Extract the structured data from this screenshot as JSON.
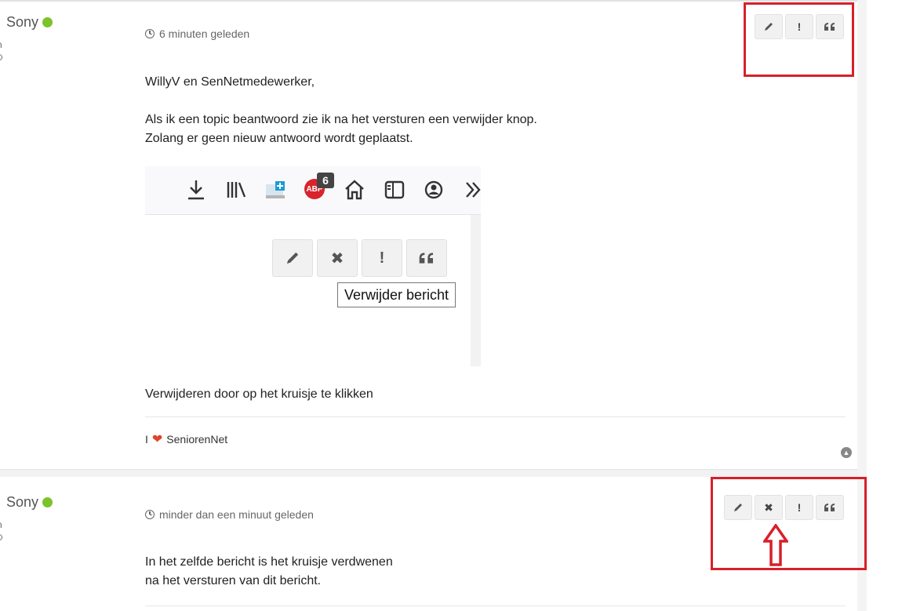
{
  "post1": {
    "author": "Sony",
    "author_meta_a": "n",
    "author_meta_b": "⊙",
    "timestamp": "6 minuten geleden",
    "greeting": "WillyV en SenNetmedewerker,",
    "line1": "Als ik een topic beantwoord zie ik na het versturen een verwijder knop.",
    "line2": "Zolang er geen nieuw antwoord wordt geplaatst.",
    "embedded": {
      "abp_label": "ABP",
      "abp_badge": "6",
      "tooltip": "Verwijder bericht",
      "buttons": [
        "edit-icon",
        "delete-icon",
        "report-icon",
        "quote-icon"
      ],
      "toolbar_icons": [
        "download-icon",
        "library-icon",
        "screenshot-icon",
        "adblock-icon",
        "home-icon",
        "sidebar-icon",
        "account-icon",
        "overflow-icon"
      ]
    },
    "footer_text": "Verwijderen door op het kruisje te klikken",
    "signature_prefix": "I",
    "signature_name": "SeniorenNet",
    "buttons": [
      "edit-icon",
      "report-icon",
      "quote-icon"
    ]
  },
  "post2": {
    "author": "Sony",
    "author_meta_a": "n",
    "author_meta_b": "⊙",
    "timestamp": "minder dan een minuut geleden",
    "line1": "In het zelfde bericht is het kruisje verdwenen",
    "line2": "na het versturen van dit bericht.",
    "buttons": [
      "edit-icon",
      "delete-icon",
      "report-icon",
      "quote-icon"
    ]
  },
  "colors": {
    "online": "#7cc22a",
    "highlight": "#d7202a",
    "heart": "#e0432c"
  }
}
